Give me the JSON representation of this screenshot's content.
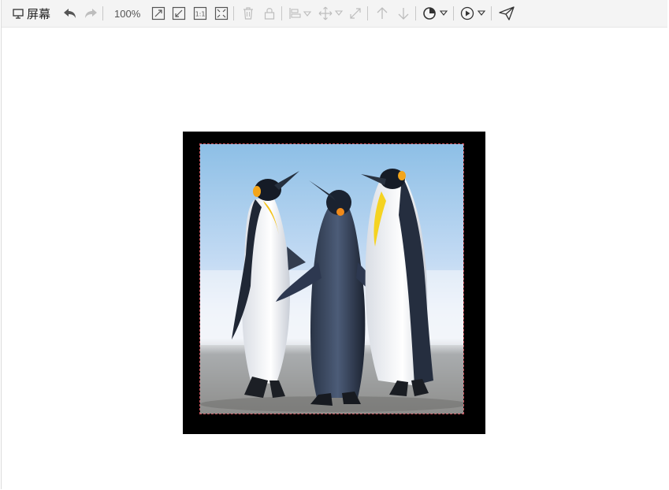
{
  "toolbar": {
    "screen_label": "屏幕",
    "zoom_level": "100%",
    "actual_size_label": "1:1",
    "icons": [
      "monitor-icon",
      "undo-icon",
      "redo-icon",
      "zoom-in-icon",
      "zoom-out-icon",
      "actual-size-icon",
      "fit-screen-icon",
      "delete-icon",
      "lock-icon",
      "align-icon",
      "move-icon",
      "resize-icon",
      "move-up-icon",
      "move-down-icon",
      "palette-icon",
      "play-icon",
      "send-icon"
    ]
  },
  "canvas": {
    "image": "penguins-photo",
    "colors": {
      "screen_background": "#000000",
      "selection_outline": "#c8505a"
    }
  }
}
